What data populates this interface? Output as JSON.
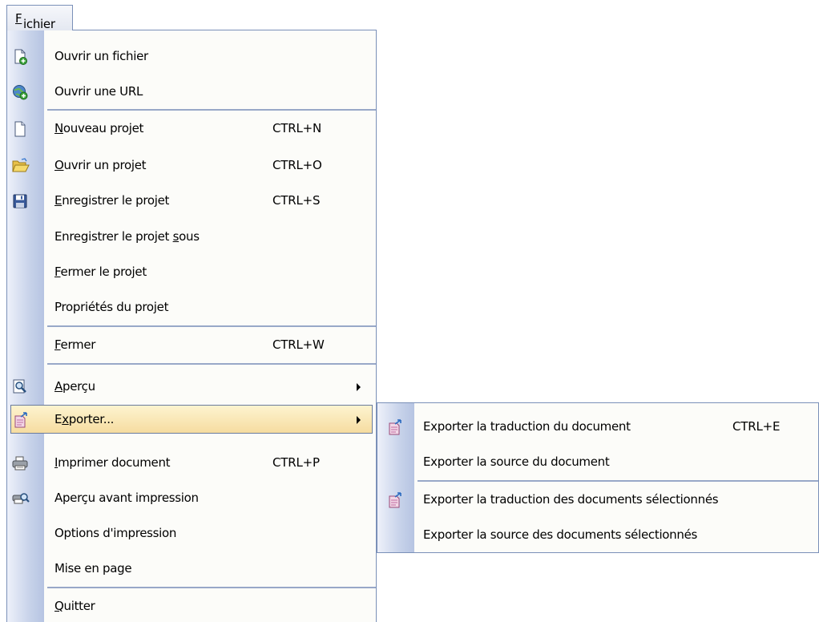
{
  "menubar": {
    "fichier": {
      "pre": "",
      "mnemonic": "F",
      "post": "ichier"
    }
  },
  "menu": {
    "items": [
      {
        "pre": "",
        "mnemonic": "",
        "post": "Ouvrir un fichier",
        "shortcut": "",
        "icon": "open-file-icon"
      },
      {
        "pre": "",
        "mnemonic": "",
        "post": "Ouvrir une URL",
        "shortcut": "",
        "icon": "open-url-icon"
      },
      {
        "pre": "",
        "mnemonic": "N",
        "post": "ouveau projet",
        "shortcut": "CTRL+N",
        "icon": "new-project-icon"
      },
      {
        "pre": "",
        "mnemonic": "O",
        "post": "uvrir un projet",
        "shortcut": "CTRL+O",
        "icon": "open-folder-icon"
      },
      {
        "pre": "",
        "mnemonic": "E",
        "post": "nregistrer le projet",
        "shortcut": "CTRL+S",
        "icon": "save-icon"
      },
      {
        "pre": "Enregistrer le projet ",
        "mnemonic": "s",
        "post": "ous",
        "shortcut": "",
        "icon": ""
      },
      {
        "pre": "",
        "mnemonic": "F",
        "post": "ermer le projet",
        "shortcut": "",
        "icon": ""
      },
      {
        "pre": "",
        "mnemonic": "",
        "post": "Propriétés du projet",
        "shortcut": "",
        "icon": ""
      },
      {
        "pre": "",
        "mnemonic": "F",
        "post": "ermer",
        "shortcut": "CTRL+W",
        "icon": ""
      },
      {
        "pre": "",
        "mnemonic": "A",
        "post": "perçu",
        "shortcut": "",
        "icon": "preview-icon"
      },
      {
        "pre": "E",
        "mnemonic": "x",
        "post": "porter...",
        "shortcut": "",
        "icon": "export-icon"
      },
      {
        "pre": "",
        "mnemonic": "I",
        "post": "mprimer document",
        "shortcut": "CTRL+P",
        "icon": "printer-icon"
      },
      {
        "pre": "",
        "mnemonic": "",
        "post": "Aperçu avant impression",
        "shortcut": "",
        "icon": "print-preview-icon"
      },
      {
        "pre": "",
        "mnemonic": "",
        "post": "Options d'impression",
        "shortcut": "",
        "icon": ""
      },
      {
        "pre": "",
        "mnemonic": "",
        "post": "Mise en page",
        "shortcut": "",
        "icon": ""
      },
      {
        "pre": "",
        "mnemonic": "Q",
        "post": "uitter",
        "shortcut": "",
        "icon": ""
      }
    ]
  },
  "submenu": {
    "items": [
      {
        "label": "Exporter la traduction du document",
        "shortcut": "CTRL+E",
        "icon": "export-icon"
      },
      {
        "label": "Exporter la source du document",
        "shortcut": "",
        "icon": ""
      },
      {
        "label": "Exporter la traduction des documents sélectionnés",
        "shortcut": "",
        "icon": "export-icon"
      },
      {
        "label": "Exporter la source des documents sélectionnés",
        "shortcut": "",
        "icon": ""
      }
    ]
  },
  "colors": {
    "menu_border": "#7a90b8",
    "gutter": "#c8d3ea",
    "highlight": "#f6dca0",
    "separator": "#98a8c8"
  }
}
